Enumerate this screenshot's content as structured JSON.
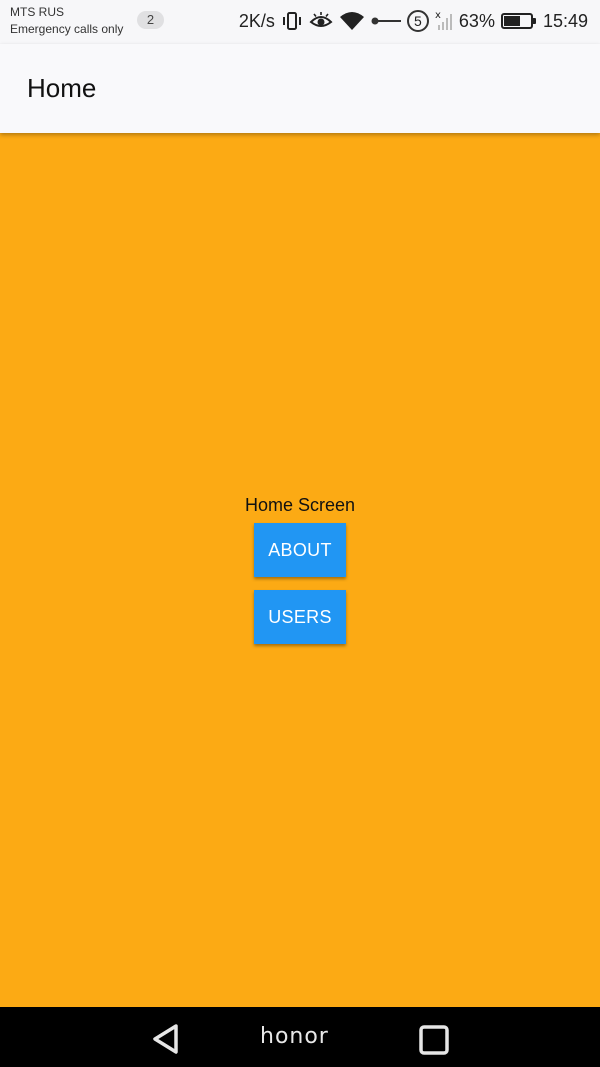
{
  "status_bar": {
    "carrier": "MTS RUS",
    "carrier_note": "Emergency calls only",
    "notification_count": "2",
    "network_speed": "2K/s",
    "sim_slot": "5",
    "battery_percent": "63%",
    "battery_level": 0.63,
    "time": "15:49"
  },
  "app_bar": {
    "title": "Home"
  },
  "main": {
    "label": "Home Screen",
    "buttons": {
      "about": "ABOUT",
      "users": "USERS"
    }
  },
  "nav_bar": {
    "brand": "honor"
  },
  "colors": {
    "background": "#fcaa14",
    "button": "#2196f3",
    "app_bar": "#f9f9fb",
    "nav_bar": "#000000"
  }
}
